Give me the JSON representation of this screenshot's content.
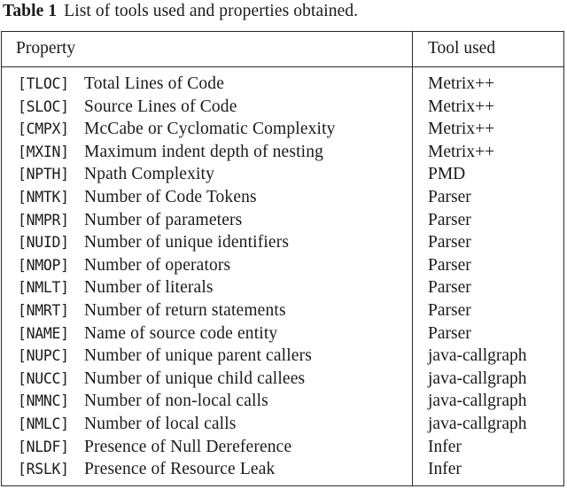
{
  "caption": {
    "label": "Table 1",
    "text": "List of tools used and properties obtained."
  },
  "table": {
    "headers": {
      "property": "Property",
      "tool": "Tool used"
    },
    "rows": [
      {
        "code": "[TLOC]",
        "description": "Total Lines of Code",
        "tool": "Metrix++"
      },
      {
        "code": "[SLOC]",
        "description": "Source Lines of Code",
        "tool": "Metrix++"
      },
      {
        "code": "[CMPX]",
        "description": "McCabe or Cyclomatic Complexity",
        "tool": "Metrix++"
      },
      {
        "code": "[MXIN]",
        "description": "Maximum indent depth of nesting",
        "tool": "Metrix++"
      },
      {
        "code": "[NPTH]",
        "description": "Npath Complexity",
        "tool": "PMD"
      },
      {
        "code": "[NMTK]",
        "description": "Number of Code Tokens",
        "tool": "Parser"
      },
      {
        "code": "[NMPR]",
        "description": "Number of parameters",
        "tool": "Parser"
      },
      {
        "code": "[NUID]",
        "description": "Number of unique identifiers",
        "tool": "Parser"
      },
      {
        "code": "[NMOP]",
        "description": "Number of operators",
        "tool": "Parser"
      },
      {
        "code": "[NMLT]",
        "description": "Number of literals",
        "tool": "Parser"
      },
      {
        "code": "[NMRT]",
        "description": "Number of return statements",
        "tool": "Parser"
      },
      {
        "code": "[NAME]",
        "description": "Name of source code entity",
        "tool": "Parser"
      },
      {
        "code": "[NUPC]",
        "description": "Number of unique parent callers",
        "tool": "java-callgraph"
      },
      {
        "code": "[NUCC]",
        "description": "Number of unique child callees",
        "tool": "java-callgraph"
      },
      {
        "code": "[NMNC]",
        "description": "Number of non-local calls",
        "tool": "java-callgraph"
      },
      {
        "code": "[NMLC]",
        "description": "Number of local calls",
        "tool": "java-callgraph"
      },
      {
        "code": "[NLDF]",
        "description": "Presence of Null Dereference",
        "tool": "Infer"
      },
      {
        "code": "[RSLK]",
        "description": "Presence of Resource Leak",
        "tool": "Infer"
      }
    ]
  }
}
